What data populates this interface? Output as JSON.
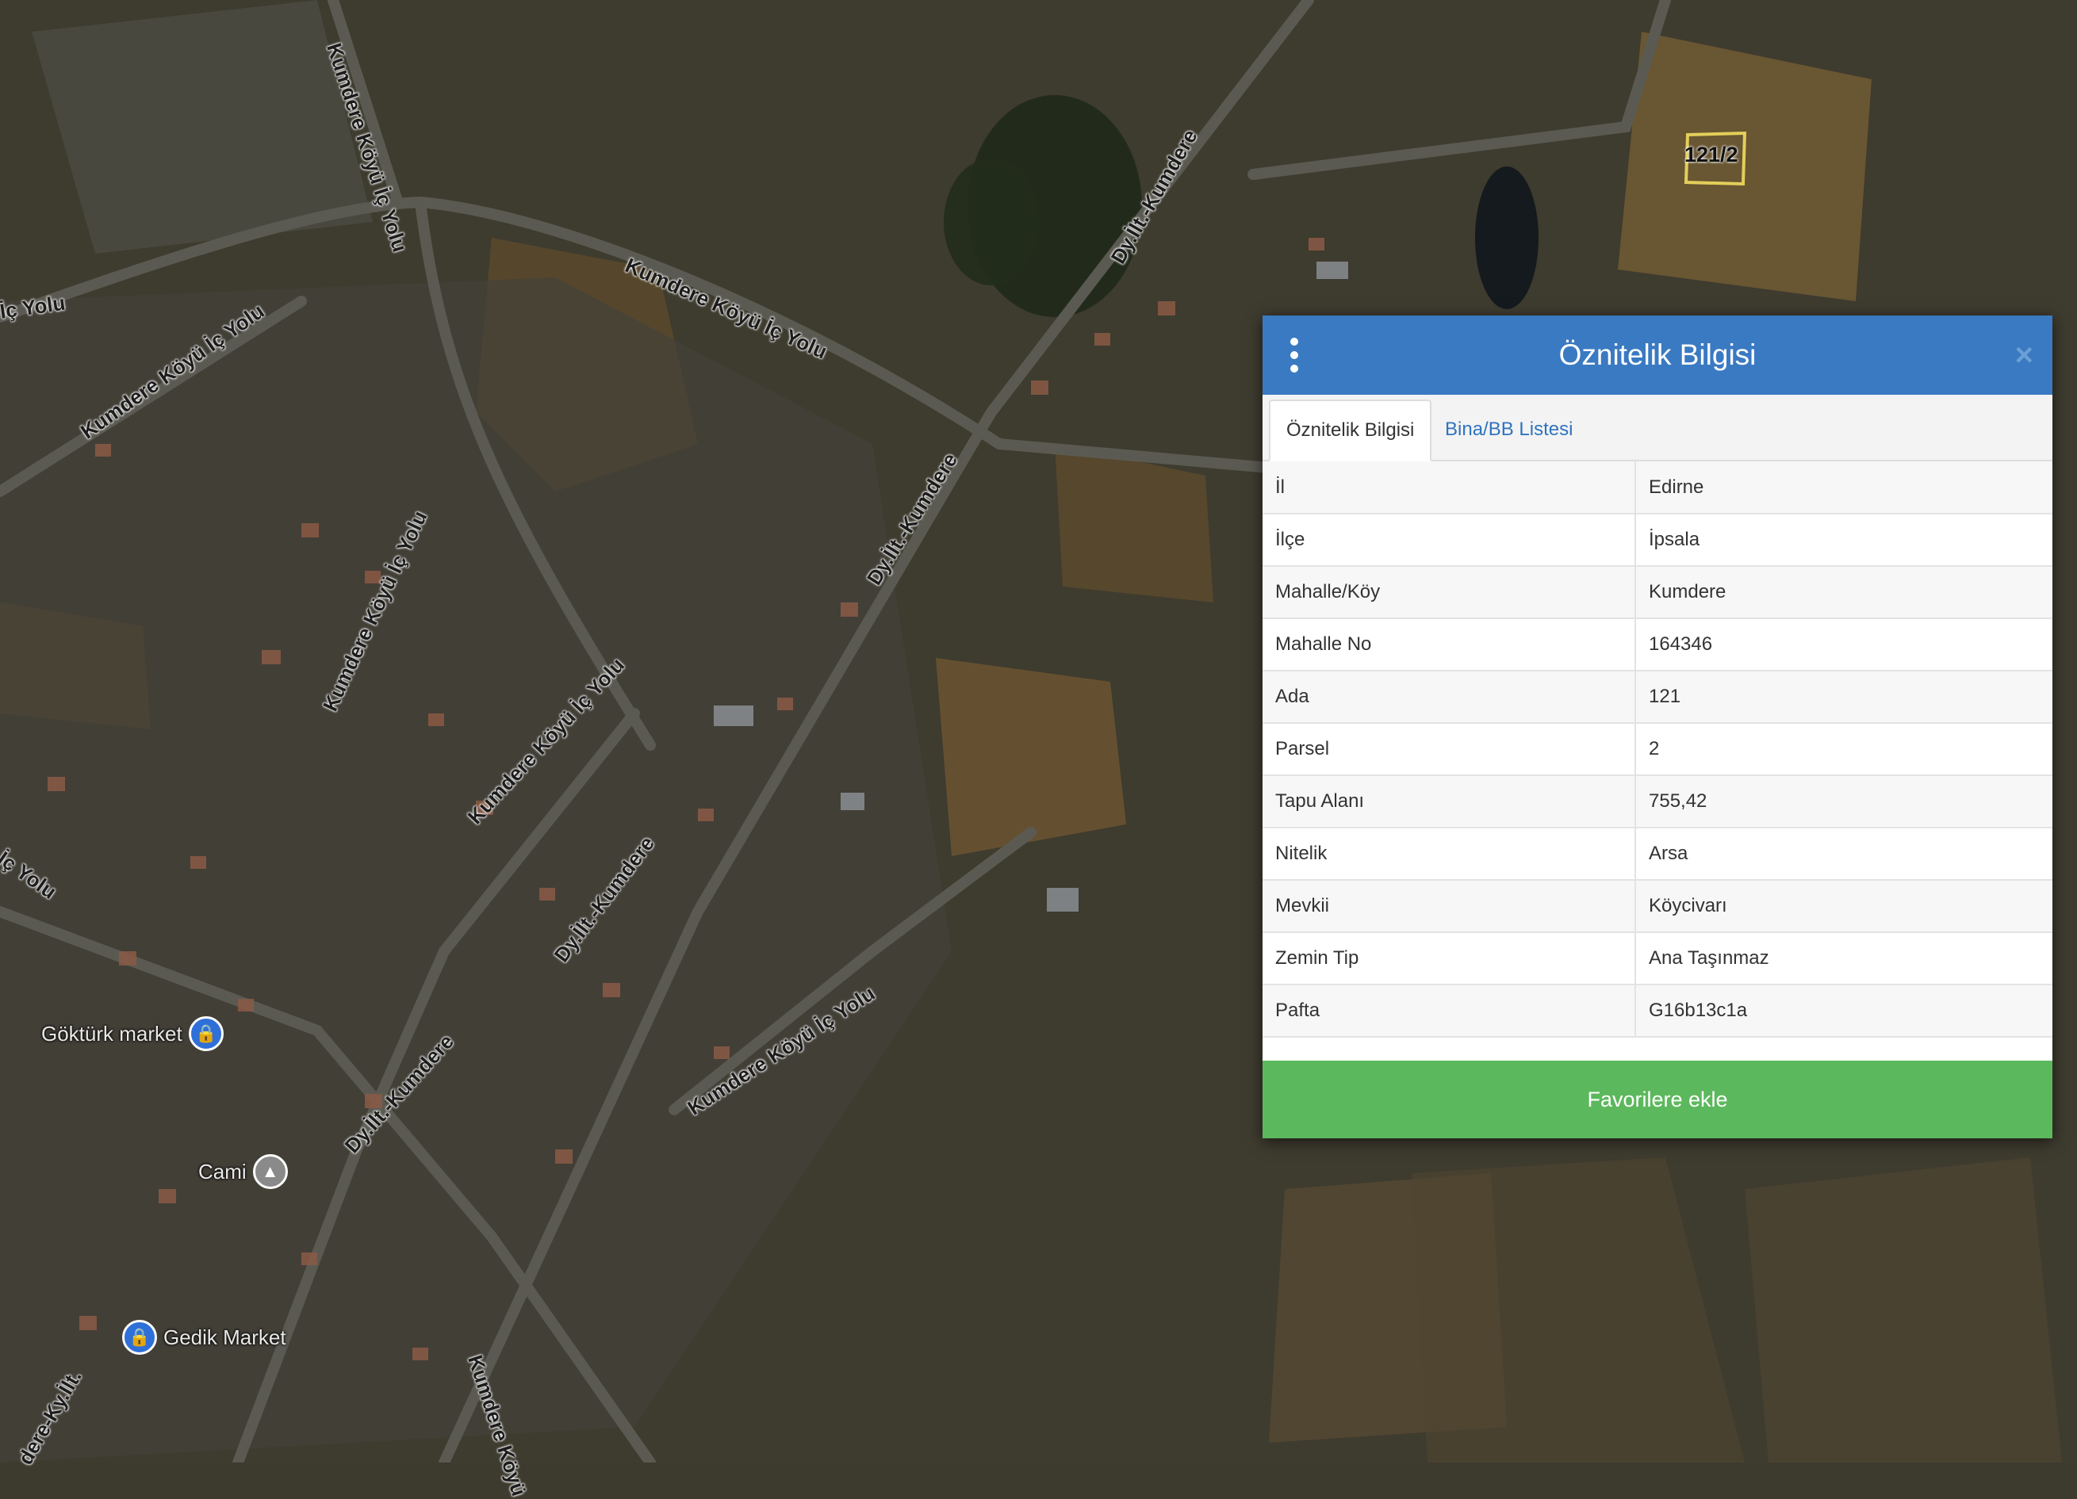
{
  "map": {
    "road_labels": [
      "Kumdere Köyü İç Yolu",
      "Kumdere Köyü İç Yolu",
      "Kumdere Köyü İç Yolu",
      "İç Yolu",
      "Dy.İlt.-Kumdere",
      "Dy.İlt.-Kumdere",
      "Kumdere Köyü İç Yolu",
      "Kumdere Köyü İç Yolu",
      "Dy.İlt.-Kumdere",
      "Kumdere Köyü İç Yolu",
      "Dy.İlt.-Kumdere",
      "İç Yolu",
      "dere-Ky.İlt.",
      "Kumdere Köyü"
    ],
    "parcel_label": "121/2",
    "pois": [
      {
        "name": "Göktürk market",
        "icon": "lock-icon"
      },
      {
        "name": "Cami",
        "icon": "mosque-icon"
      },
      {
        "name": "Gedik Market",
        "icon": "lock-icon"
      }
    ]
  },
  "panel": {
    "title": "Öznitelik Bilgisi",
    "menu_icon": "vertical-dots-icon",
    "close_icon": "close-icon",
    "close_glyph": "×",
    "tabs": [
      {
        "label": "Öznitelik Bilgisi",
        "active": true
      },
      {
        "label": "Bina/BB Listesi",
        "active": false
      }
    ],
    "rows": [
      {
        "key": "İl",
        "value": "Edirne"
      },
      {
        "key": "İlçe",
        "value": "İpsala"
      },
      {
        "key": "Mahalle/Köy",
        "value": "Kumdere"
      },
      {
        "key": "Mahalle No",
        "value": "164346"
      },
      {
        "key": "Ada",
        "value": "121"
      },
      {
        "key": "Parsel",
        "value": "2"
      },
      {
        "key": "Tapu Alanı",
        "value": "755,42"
      },
      {
        "key": "Nitelik",
        "value": "Arsa"
      },
      {
        "key": "Mevkii",
        "value": "Köycivarı"
      },
      {
        "key": "Zemin Tip",
        "value": "Ana Taşınmaz"
      },
      {
        "key": "Pafta",
        "value": "G16b13c1a"
      }
    ],
    "favorite_button": "Favorilere ekle"
  },
  "colors": {
    "header": "#3a7ac2",
    "button": "#5cb85c",
    "link": "#2f74c0"
  }
}
